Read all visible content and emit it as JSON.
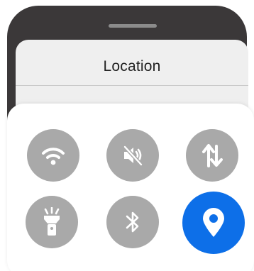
{
  "sheet": {
    "title": "Location"
  },
  "quick_settings": {
    "tiles": [
      {
        "name": "wifi",
        "icon": "wifi-icon",
        "state": "off"
      },
      {
        "name": "sound",
        "icon": "volume-mute-icon",
        "state": "off"
      },
      {
        "name": "mobile-data",
        "icon": "data-transfer-icon",
        "state": "off"
      },
      {
        "name": "flashlight",
        "icon": "flashlight-icon",
        "state": "off"
      },
      {
        "name": "bluetooth",
        "icon": "bluetooth-icon",
        "state": "off"
      },
      {
        "name": "location",
        "icon": "location-pin-icon",
        "state": "on"
      }
    ],
    "colors": {
      "inactive": "#a9a9a9",
      "active": "#0d6fe8",
      "icon": "#ffffff"
    }
  }
}
